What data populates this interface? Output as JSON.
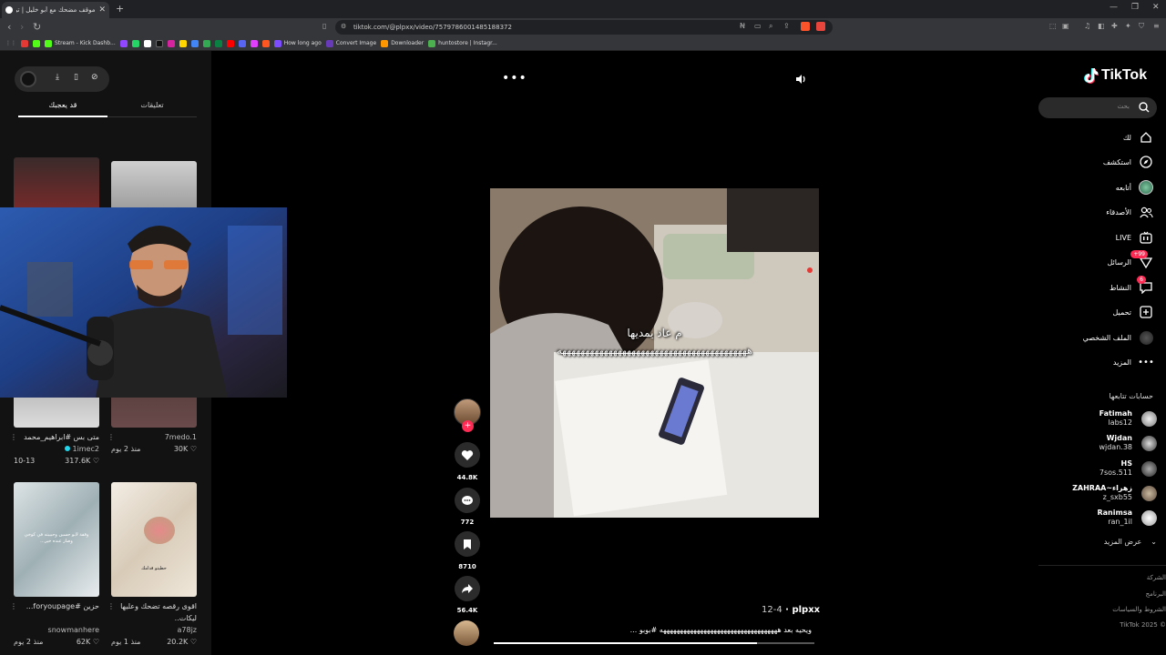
{
  "browser": {
    "tab_title": "موقف مضحك مع أبو خليل | تيك",
    "url": "tiktok.com/@plpxx/video/7579786001485188372",
    "bookmarks": [
      "Stream - Kick Dashb...",
      "How long ago",
      "Convert Image",
      "Downloader",
      "huntostore | Instagr..."
    ]
  },
  "left_panel": {
    "tabs": [
      "تعليقات",
      "قد يعجبك"
    ],
    "videos": [
      {
        "title": "",
        "author": "",
        "likes": "",
        "age": ""
      },
      {
        "title": "",
        "author": "",
        "likes": "",
        "age": ""
      },
      {
        "title": "متى بس #ابراهيم_محمد",
        "author": "1imec2",
        "likes": "317.6K",
        "age": "10-13"
      },
      {
        "title": "",
        "author": "7medo.1",
        "likes": "30K",
        "age": "منذ 2 يوم"
      },
      {
        "title": "حزين #foryoupage...",
        "author": "snowmanhere",
        "likes": "62K",
        "age": "منذ 2 يوم",
        "overlay": "وقفة لابو حسين وحبيبته في كوخي وصار عنده خير..."
      },
      {
        "title": "اقوى رقصه تضحك وعليها ليكات..",
        "author": "a78jz",
        "likes": "20.2K",
        "age": "منذ 1 يوم",
        "overlay": "حطيتو قدامك"
      }
    ]
  },
  "video": {
    "caption_line1": "م عاد يمديها",
    "caption_line2": "هههههههههههههههههههههههههههههههههههههههههه",
    "likes": "44.8K",
    "comments": "772",
    "saves": "8710",
    "shares": "56.4K",
    "author": "plpxx",
    "date": "12-4",
    "description": "ويحيه بعد هههههههههههههههههههههههههههههههههههه #بوبو ...",
    "progress": 0.82
  },
  "sidebar": {
    "logo": "TikTok",
    "search_placeholder": "بحث",
    "nav": [
      {
        "label": "لك",
        "icon": "home-icon"
      },
      {
        "label": "استكشف",
        "icon": "compass-icon"
      },
      {
        "label": "أتابعه",
        "icon": "avatar-icon"
      },
      {
        "label": "الأصدقاء",
        "icon": "friends-icon"
      },
      {
        "label": "LIVE",
        "icon": "live-icon"
      },
      {
        "label": "الرسائل",
        "icon": "messages-icon",
        "badge": "+99"
      },
      {
        "label": "النشاط",
        "icon": "activity-icon",
        "badge": "6"
      },
      {
        "label": "تحميل",
        "icon": "upload-icon"
      },
      {
        "label": "الملف الشخصي",
        "icon": "profile-icon"
      },
      {
        "label": "المزيد",
        "icon": "more-icon"
      }
    ],
    "following_title": "حسابات تتابعها",
    "accounts": [
      {
        "name": "Fatimah",
        "handle": "labs12"
      },
      {
        "name": "Wjdan",
        "handle": "wjdan.38"
      },
      {
        "name": "HS",
        "handle": "7sos.511"
      },
      {
        "name": "ZAHRAA~زهراء",
        "handle": "z_sxb55"
      },
      {
        "name": "Ranimsa",
        "handle": "ran_1il"
      }
    ],
    "see_more": "عرض المزيد",
    "footer": [
      "الشركة",
      "البرنامج",
      "الشروط والسياسات",
      "TikTok 2025 ©"
    ]
  }
}
